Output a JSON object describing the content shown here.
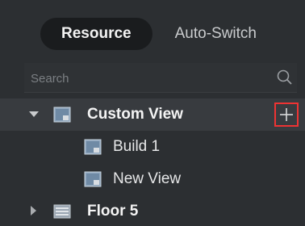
{
  "tabs": [
    {
      "label": "Resource",
      "active": true
    },
    {
      "label": "Auto-Switch",
      "active": false
    }
  ],
  "search": {
    "placeholder": "Search",
    "value": ""
  },
  "tree": {
    "custom_view": {
      "label": "Custom View",
      "expanded": true,
      "selected": true
    },
    "children": [
      {
        "label": "Build 1"
      },
      {
        "label": "New View"
      }
    ],
    "floor5": {
      "label": "Floor 5",
      "expanded": false
    }
  },
  "icons": {
    "search": "search-icon",
    "view": "view-icon",
    "folder": "folder-icon",
    "add": "plus-icon"
  },
  "colors": {
    "background": "#2c2f32",
    "active_tab_bg": "#1a1c1e",
    "selected_row": "#383b3f",
    "add_highlight": "#e33333"
  }
}
